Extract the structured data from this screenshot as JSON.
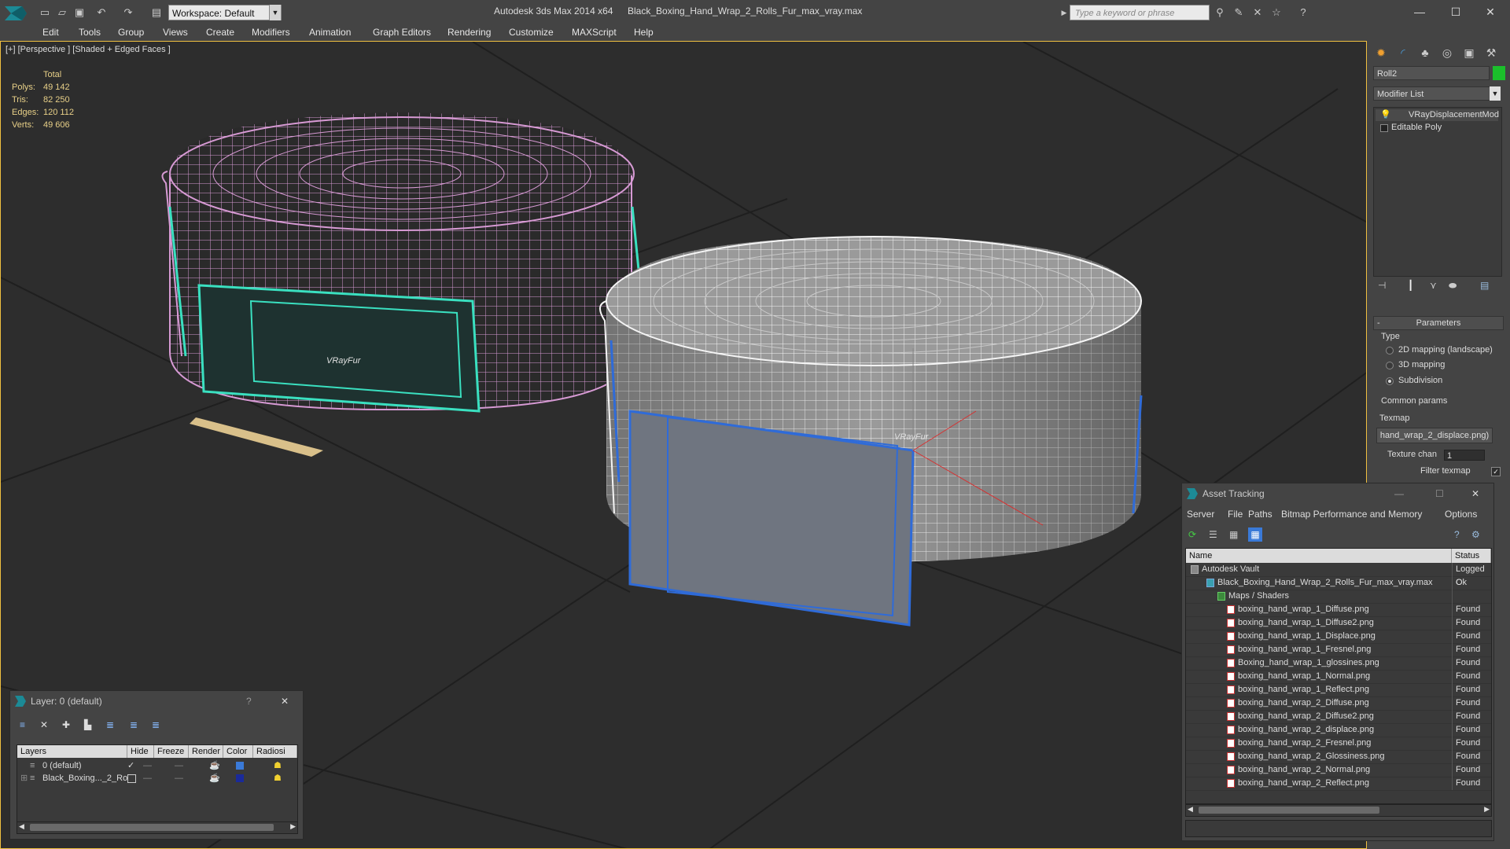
{
  "app": {
    "title": "Autodesk 3ds Max  2014 x64",
    "file": "Black_Boxing_Hand_Wrap_2_Rolls_Fur_max_vray.max",
    "workspace": "Workspace: Default",
    "search_placeholder": "Type a keyword or phrase"
  },
  "menu": [
    "Edit",
    "Tools",
    "Group",
    "Views",
    "Create",
    "Modifiers",
    "Animation",
    "Graph Editors",
    "Rendering",
    "Customize",
    "MAXScript",
    "Help"
  ],
  "viewport": {
    "label": "[+] [Perspective ] [Shaded + Edged Faces ]",
    "stats": {
      "header": "Total",
      "rows": [
        {
          "k": "Polys:",
          "v": "49 142"
        },
        {
          "k": "Tris:",
          "v": "82 250"
        },
        {
          "k": "Edges:",
          "v": "120 112"
        },
        {
          "k": "Verts:",
          "v": "49 606"
        }
      ]
    },
    "fur_label_1": "VRayFur",
    "fur_label_2": "VRayFur"
  },
  "command_panel": {
    "object_name": "Roll2",
    "object_color": "#1bbf2b",
    "modifier_list": "Modifier List",
    "stack": [
      "VRayDisplacementMod",
      "Editable Poly"
    ],
    "parameters": {
      "header": "Parameters",
      "type_label": "Type",
      "options": [
        "2D mapping (landscape)",
        "3D mapping",
        "Subdivision"
      ],
      "selected": "Subdivision",
      "common_params": "Common params",
      "texmap_label": "Texmap",
      "texmap_value": "hand_wrap_2_displace.png)",
      "texture_chan_label": "Texture chan",
      "texture_chan_value": "1",
      "filter_texmap_label": "Filter texmap"
    }
  },
  "asset_tracking": {
    "title": "Asset Tracking",
    "menu": [
      "Server",
      "File",
      "Paths",
      "Bitmap Performance and Memory",
      "Options"
    ],
    "columns": [
      "Name",
      "Status"
    ],
    "rows": [
      {
        "name": "Autodesk Vault",
        "status": "Logged C",
        "level": 0
      },
      {
        "name": "Black_Boxing_Hand_Wrap_2_Rolls_Fur_max_vray.max",
        "status": "Ok",
        "level": 1
      },
      {
        "name": "Maps / Shaders",
        "status": "",
        "level": 2
      },
      {
        "name": "boxing_hand_wrap_1_Diffuse.png",
        "status": "Found",
        "level": 3
      },
      {
        "name": "boxing_hand_wrap_1_Diffuse2.png",
        "status": "Found",
        "level": 3
      },
      {
        "name": "boxing_hand_wrap_1_Displace.png",
        "status": "Found",
        "level": 3
      },
      {
        "name": "boxing_hand_wrap_1_Fresnel.png",
        "status": "Found",
        "level": 3
      },
      {
        "name": "Boxing_hand_wrap_1_glossines.png",
        "status": "Found",
        "level": 3
      },
      {
        "name": "boxing_hand_wrap_1_Normal.png",
        "status": "Found",
        "level": 3
      },
      {
        "name": "boxing_hand_wrap_1_Reflect.png",
        "status": "Found",
        "level": 3
      },
      {
        "name": "boxing_hand_wrap_2_Diffuse.png",
        "status": "Found",
        "level": 3
      },
      {
        "name": "boxing_hand_wrap_2_Diffuse2.png",
        "status": "Found",
        "level": 3
      },
      {
        "name": "boxing_hand_wrap_2_displace.png",
        "status": "Found",
        "level": 3
      },
      {
        "name": "boxing_hand_wrap_2_Fresnel.png",
        "status": "Found",
        "level": 3
      },
      {
        "name": "boxing_hand_wrap_2_Glossiness.png",
        "status": "Found",
        "level": 3
      },
      {
        "name": "boxing_hand_wrap_2_Normal.png",
        "status": "Found",
        "level": 3
      },
      {
        "name": "boxing_hand_wrap_2_Reflect.png",
        "status": "Found",
        "level": 3
      }
    ]
  },
  "layer_manager": {
    "title": "Layer: 0 (default)",
    "columns": [
      "Layers",
      "Hide",
      "Freeze",
      "Render",
      "Color",
      "Radiosi"
    ],
    "rows": [
      {
        "name": "0 (default)",
        "color": "#3a7ad8"
      },
      {
        "name": "Black_Boxing..._2_Ro",
        "color": "#1a2a9a"
      }
    ]
  }
}
